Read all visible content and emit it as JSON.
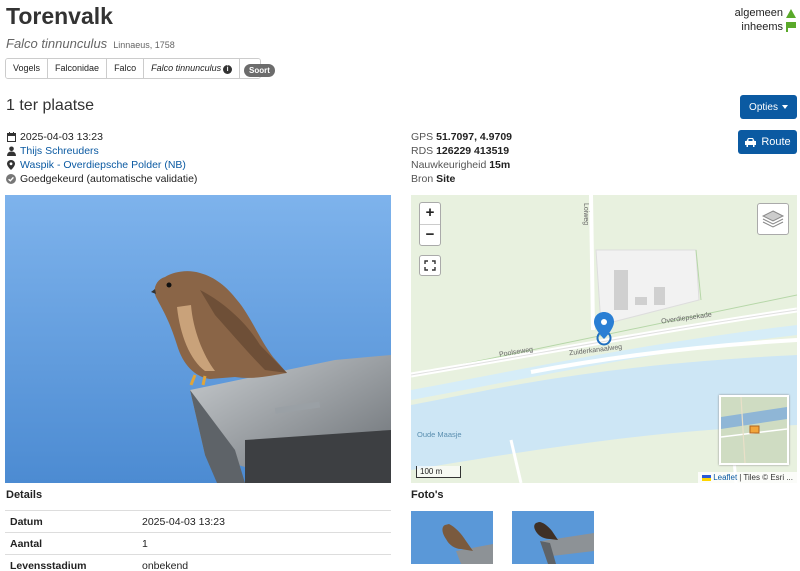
{
  "species": {
    "common_name": "Torenvalk",
    "scientific_name": "Falco tinnunculus",
    "author": "Linnaeus, 1758"
  },
  "status": {
    "algemeen": "algemeen",
    "inheems": "inheems"
  },
  "taxonomy": {
    "items": [
      "Vogels",
      "Falconidae",
      "Falco",
      "Falco tinnunculus"
    ],
    "rank_badge": "Soort"
  },
  "observation": {
    "title": "1 ter plaatse",
    "datetime": "2025-04-03 13:23",
    "observer": "Thijs Schreuders",
    "location": "Waspik - Overdiepsche Polder (NB)",
    "validation": "Goedgekeurd (automatische validatie)"
  },
  "buttons": {
    "opties": "Opties",
    "route": "Route"
  },
  "location_info": {
    "gps_label": "GPS",
    "gps_value": "51.7097, 4.9709",
    "rds_label": "RDS",
    "rds_value": "126229 413519",
    "accuracy_label": "Nauwkeurigheid",
    "accuracy_value": "15m",
    "source_label": "Bron",
    "source_value": "Site"
  },
  "map": {
    "zoom_in": "+",
    "zoom_out": "−",
    "labels": {
      "road1": "Loiweg",
      "road2": "Overdiepsekade",
      "road3": "Poolseweg",
      "road4": "Zuiderkanaalweg",
      "water": "Oude Maasje"
    },
    "scale": "100 m",
    "attribution_leaflet": "Leaflet",
    "attribution_tiles": "| Tiles © Esri ..."
  },
  "details": {
    "heading": "Details",
    "rows": [
      {
        "key": "Datum",
        "value": "2025-04-03 13:23"
      },
      {
        "key": "Aantal",
        "value": "1"
      },
      {
        "key": "Levensstadium",
        "value": "onbekend"
      }
    ]
  },
  "photos": {
    "heading": "Foto's"
  },
  "colors": {
    "primary": "#0b5aa2",
    "status_green": "#5aa92a",
    "sky": "#5a98d8"
  }
}
